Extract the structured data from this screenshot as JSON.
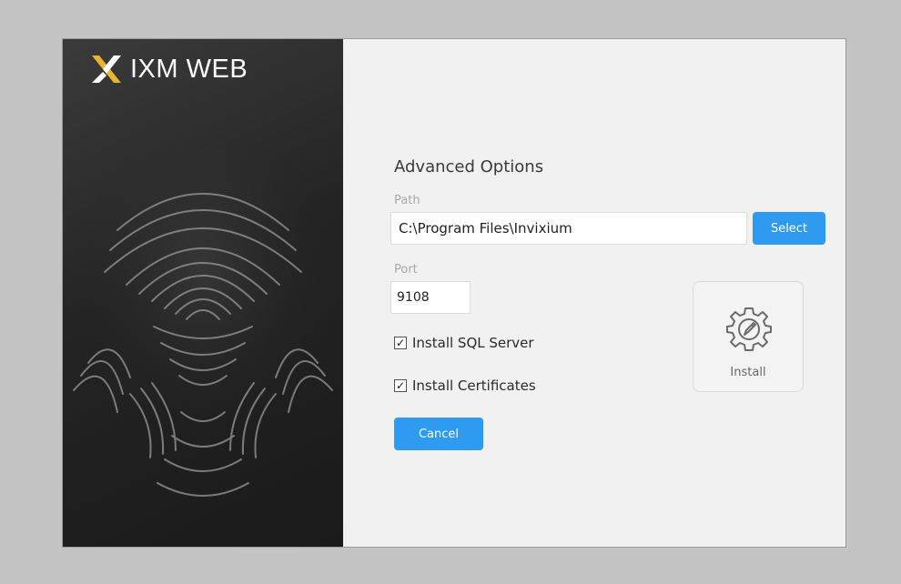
{
  "app": {
    "logo_text": "IXM WEB",
    "logo_icon": "ixm-x-logo-icon"
  },
  "options": {
    "title": "Advanced Options",
    "path": {
      "label": "Path",
      "value": "C:\\Program Files\\Invixium"
    },
    "select_label": "Select",
    "port": {
      "label": "Port",
      "value": "9108"
    },
    "checkboxes": [
      {
        "label": "Install SQL Server",
        "checked": true
      },
      {
        "label": "Install Certificates",
        "checked": true
      }
    ],
    "cancel_label": "Cancel",
    "install_label": "Install",
    "install_icon": "gear-pencil-icon"
  },
  "colors": {
    "accent": "#2e9bf0",
    "logo_gold": "#e8b530",
    "left_panel_bg": "#242424",
    "right_panel_bg": "#f1f1f1"
  }
}
